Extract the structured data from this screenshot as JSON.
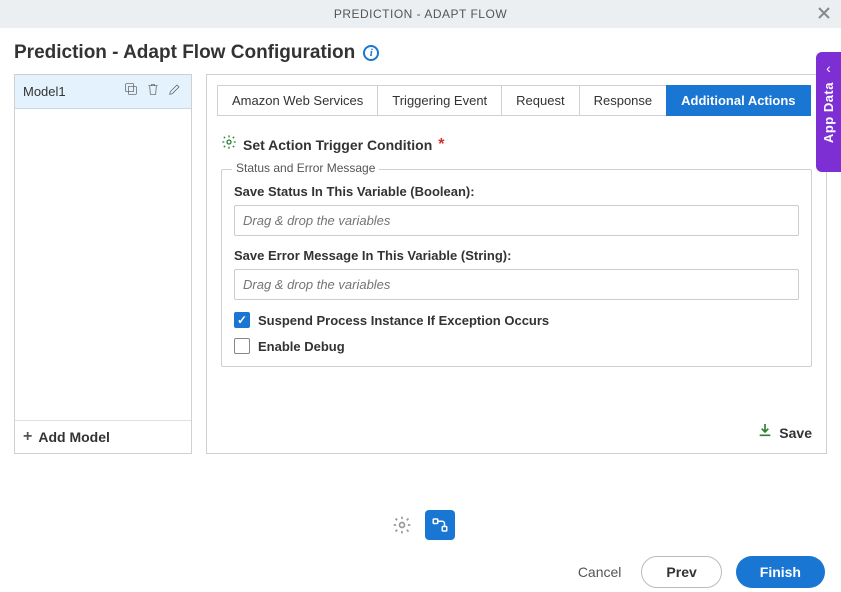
{
  "titlebar": {
    "text": "PREDICTION - ADAPT FLOW"
  },
  "header": {
    "title": "Prediction - Adapt Flow Configuration"
  },
  "sidebar": {
    "model_name": "Model1",
    "add_model_label": "Add Model"
  },
  "tabs": [
    {
      "label": "Amazon Web Services",
      "active": false
    },
    {
      "label": "Triggering Event",
      "active": false
    },
    {
      "label": "Request",
      "active": false
    },
    {
      "label": "Response",
      "active": false
    },
    {
      "label": "Additional Actions",
      "active": true
    }
  ],
  "action": {
    "heading": "Set Action Trigger Condition",
    "required_marker": "*"
  },
  "fieldset": {
    "legend": "Status and Error Message",
    "status_label": "Save Status In This Variable (Boolean):",
    "status_placeholder": "Drag & drop the variables",
    "error_label": "Save Error Message In This Variable (String):",
    "error_placeholder": "Drag & drop the variables",
    "suspend_label": "Suspend Process Instance If Exception Occurs",
    "suspend_checked": true,
    "debug_label": "Enable Debug",
    "debug_checked": false
  },
  "save_label": "Save",
  "app_data_tab": "App Data",
  "buttons": {
    "cancel": "Cancel",
    "prev": "Prev",
    "finish": "Finish"
  }
}
